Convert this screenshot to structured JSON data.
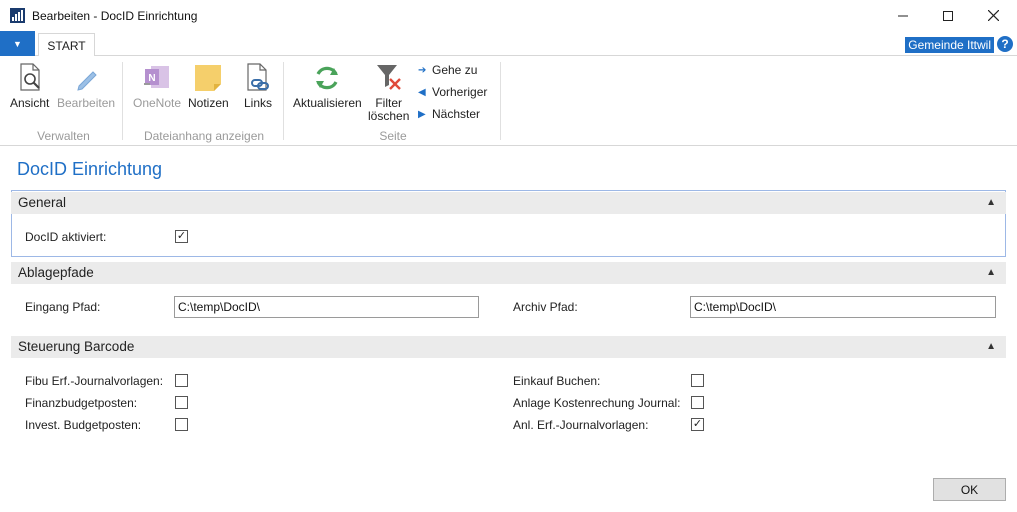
{
  "window": {
    "title": "Bearbeiten - DocID Einrichtung",
    "minimize": "—",
    "maximize": "☐",
    "close": "✕"
  },
  "tabs": {
    "menu_glyph": "▼",
    "start": "START",
    "company": "Gemeinde Ittwil",
    "help": "?"
  },
  "ribbon": {
    "verwalten": {
      "label": "Verwalten",
      "ansicht": "Ansicht",
      "bearbeiten": "Bearbeiten"
    },
    "dateianhang": {
      "label": "Dateianhang anzeigen",
      "onenote": "OneNote",
      "notizen": "Notizen",
      "links": "Links"
    },
    "seite": {
      "label": "Seite",
      "aktualisieren": "Aktualisieren",
      "filter_line1": "Filter",
      "filter_line2": "löschen",
      "gehe_zu": "Gehe zu",
      "vorheriger": "Vorheriger",
      "naechster": "Nächster"
    }
  },
  "page": {
    "title": "DocID Einrichtung"
  },
  "sections": {
    "general": {
      "title": "General",
      "docid_label": "DocID aktiviert:",
      "docid_checked": true
    },
    "ablagepfade": {
      "title": "Ablagepfade",
      "eingang_label": "Eingang Pfad:",
      "eingang_value": "C:\\temp\\DocID\\",
      "archiv_label": "Archiv Pfad:",
      "archiv_value": "C:\\temp\\DocID\\"
    },
    "barcode": {
      "title": "Steuerung Barcode",
      "left": [
        {
          "label": "Fibu Erf.-Journalvorlagen:",
          "checked": false
        },
        {
          "label": "Finanzbudgetposten:",
          "checked": false
        },
        {
          "label": "Invest. Budgetposten:",
          "checked": false
        }
      ],
      "right": [
        {
          "label": "Einkauf Buchen:",
          "checked": false
        },
        {
          "label": "Anlage Kostenrechung Journal:",
          "checked": false
        },
        {
          "label": "Anl. Erf.-Journalvorlagen:",
          "checked": true
        }
      ]
    }
  },
  "footer": {
    "ok": "OK"
  },
  "colors": {
    "accent": "#1f6fc6",
    "section_bg": "#ebebeb",
    "disabled_text": "#9a9a9a"
  },
  "check_glyph": "✓",
  "collapse_glyph": "▲"
}
